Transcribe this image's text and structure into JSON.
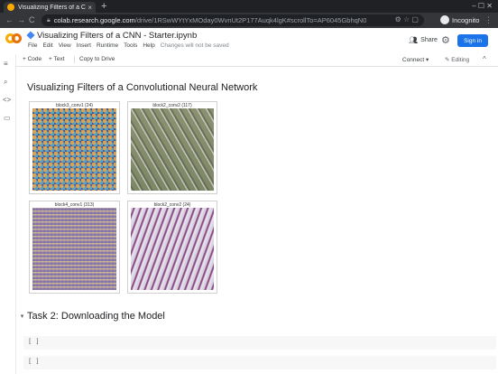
{
  "browser": {
    "tab_title": "Visualizing Filters of a CN",
    "tab_close": "×",
    "new_tab": "+",
    "window_controls": "–  ☐  ✕",
    "back": "←",
    "forward": "→",
    "reload": "C",
    "url_host": "colab.research.google.com",
    "url_path": "/drive/1RSwWYtYxMOday0WvnUt2P177Auqk4lgK#scrollTo=AP6045GbhqN0",
    "omni_icons": "⚙ ☆ ▢",
    "profile_label": "Incognito",
    "menu": "⋮"
  },
  "colab": {
    "notebook_title": "Visualizing Filters of a CNN - Starter.ipynb",
    "menus": [
      "File",
      "Edit",
      "View",
      "Insert",
      "Runtime",
      "Tools",
      "Help"
    ],
    "save_note": "Changes will not be saved",
    "share_label": "Share",
    "gear": "⚙",
    "signin_label": "Sign in",
    "toolbar": {
      "add_code": "+ Code",
      "add_text": "+ Text",
      "copy_drive": "Copy to Drive",
      "connect": "Connect ▾",
      "editing": "Editing",
      "collapse": "^"
    },
    "rail": [
      "≡",
      "⌕",
      "<>",
      "▭"
    ]
  },
  "notebook": {
    "heading": "Visualizing Filters of a Convolutional Neural Network",
    "figures": [
      {
        "caption": "block3_conv1 (24)"
      },
      {
        "caption": "block2_conv2 (117)"
      },
      {
        "caption": "block4_conv1 (313)"
      },
      {
        "caption": "block2_conv2 (24)"
      }
    ],
    "section_arrow": "▾",
    "section_title": "Task 2: Downloading the Model",
    "cell_brackets": [
      "[ ]",
      "[ ]"
    ]
  }
}
